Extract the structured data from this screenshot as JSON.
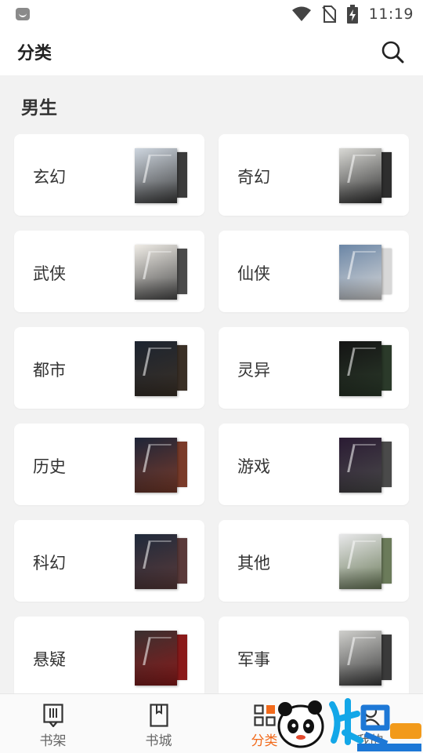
{
  "status_bar": {
    "time": "11:19",
    "icons": [
      "app-notification-icon",
      "wifi-icon",
      "no-sim-icon",
      "battery-charging-icon"
    ]
  },
  "header": {
    "title": "分类",
    "search_icon": "search-icon"
  },
  "section": {
    "title": "男生"
  },
  "categories": [
    {
      "label": "玄幻",
      "cover_colors": [
        "#ced6df",
        "#3b3b3b"
      ]
    },
    {
      "label": "奇幻",
      "cover_colors": [
        "#d9d9d5",
        "#2e2e2e"
      ]
    },
    {
      "label": "武侠",
      "cover_colors": [
        "#efece6",
        "#4a4a4a"
      ]
    },
    {
      "label": "仙侠",
      "cover_colors": [
        "#6b86a6",
        "#d8d8d8"
      ]
    },
    {
      "label": "都市",
      "cover_colors": [
        "#1c2430",
        "#3a3026"
      ]
    },
    {
      "label": "灵异",
      "cover_colors": [
        "#141414",
        "#2b3a2a"
      ]
    },
    {
      "label": "历史",
      "cover_colors": [
        "#1e2538",
        "#7a3b2a"
      ]
    },
    {
      "label": "游戏",
      "cover_colors": [
        "#2a1b33",
        "#4a4a4a"
      ]
    },
    {
      "label": "科幻",
      "cover_colors": [
        "#1f2a3b",
        "#5a3a3a"
      ]
    },
    {
      "label": "其他",
      "cover_colors": [
        "#e8e8ea",
        "#6b7b5a"
      ]
    },
    {
      "label": "悬疑",
      "cover_colors": [
        "#3a3030",
        "#8a1a1a"
      ]
    },
    {
      "label": "军事",
      "cover_colors": [
        "#cfcfcc",
        "#3a3a3a"
      ]
    }
  ],
  "tabbar": {
    "tabs": [
      {
        "label": "书架",
        "icon": "bookshelf-icon"
      },
      {
        "label": "书城",
        "icon": "bookstore-icon"
      },
      {
        "label": "分类",
        "icon": "category-grid-icon"
      },
      {
        "label": "我的",
        "icon": "profile-icon"
      }
    ],
    "active_index": 2
  },
  "colors": {
    "accent": "#f26a1b",
    "background": "#f2f2f2",
    "card": "#ffffff"
  }
}
